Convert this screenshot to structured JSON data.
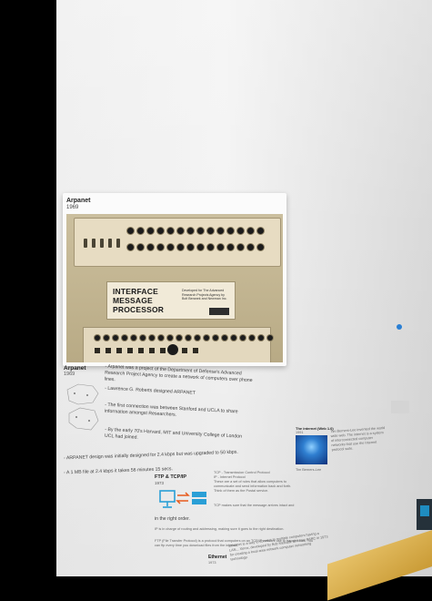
{
  "photo": {
    "title": "Arpanet",
    "year": "1969",
    "plate_line1": "INTERFACE",
    "plate_line2": "MESSAGE",
    "plate_line3": "PROCESSOR",
    "plate_small": "Developed for The Advanced Research Projects Agency by Bolt Beranek and Newman Inc.",
    "plate_logo": "bbn"
  },
  "arpanet": {
    "title": "Arpanet",
    "year": "1969",
    "bullets": [
      "- Arpanet was a project of the Department of Defense's Advanced Research Project Agency to create a network of computers over phone lines.",
      "- Lawrence G. Roberts designed ARPANET",
      "- The first connection was between Stanford and UCLA to share information amongst Researchers.",
      "- By the early 70's Harvard, MIT and University College of London UCL had joined.",
      "- ARPANET design was initially designed for 2.4 kbps but was upgraded to 50 kbps.",
      "- A 1 MB file at 2.4 kbps it takes 56 minutes 15 secs."
    ]
  },
  "ftp": {
    "title": "FTP & TCP/IP",
    "year": "1973",
    "tcp_lines": [
      "TCP - Transmission Control Protocol",
      "IP - Internet Protocol",
      "These are a set of rules that allow computers to communicate and send information back and forth.",
      "Think of them as the Postal service."
    ],
    "tcp_note": "TCP makes sure that the message arrives intact and",
    "right_order": "in the right order.",
    "ip_note": "IP is in charge of routing and addressing, making sure it goes to the right destination.",
    "ftp_note": "FTP (File Transfer Protocol) is a protocol that computers on an TCP/IP network use to transfer files. You can ftp every time you download files from the internet."
  },
  "ethernet": {
    "title": "Ethernet",
    "year": "1973",
    "text": "Ethernet is a way to connect to multiple computers having a LAN... Xerox, developed by Bob Metcalfe at Xerox PARC in 1973 for creating a local area network computer networking technology."
  },
  "internet": {
    "title": "The internet (Web 1.0)",
    "year": "1991",
    "caption": "Tim Berners-Lee",
    "text": "Tim Berners-Lee invented the world wide web. The internet is a system of interconnected computer networks that use the Internet protocol suite."
  }
}
